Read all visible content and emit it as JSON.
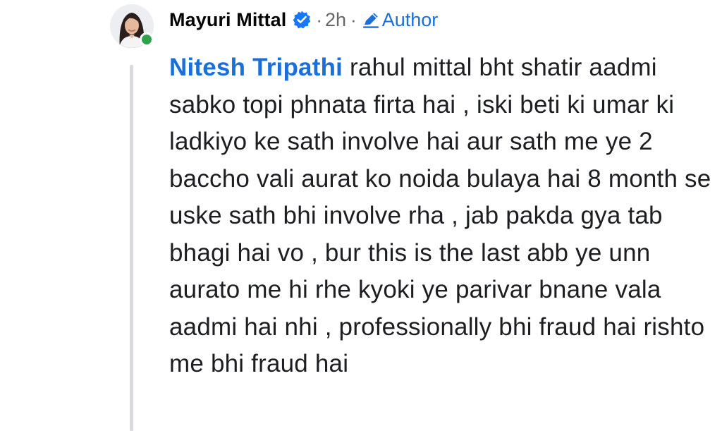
{
  "comment": {
    "author_name": "Mayuri Mittal",
    "verified": true,
    "separator": "·",
    "timestamp": "2h",
    "author_badge": "Author",
    "mention": "Nitesh Tripathi",
    "text": " rahul mittal bht shatir aadmi sabko topi phnata firta hai , iski beti ki umar ki ladkiyo ke sath involve hai aur sath me ye 2 baccho vali aurat ko noida bulaya hai 8 month se uske sath bhi involve rha , jab pakda gya tab bhagi hai vo , bur this is the last abb ye unn aurato me hi rhe kyoki ye parivar bnane vala aadmi hai nhi , professionally bhi fraud hai rishto me bhi fraud hai",
    "online_status": "online"
  },
  "icons": {
    "verified": "verified-badge-icon",
    "author": "pencil-icon",
    "online": "online-dot-icon"
  },
  "colors": {
    "link_blue": "#1b6fd8",
    "verified_blue": "#1877f2",
    "online_green": "#31a24c",
    "meta_gray": "#65676b",
    "thread_line": "#d9dadd"
  }
}
